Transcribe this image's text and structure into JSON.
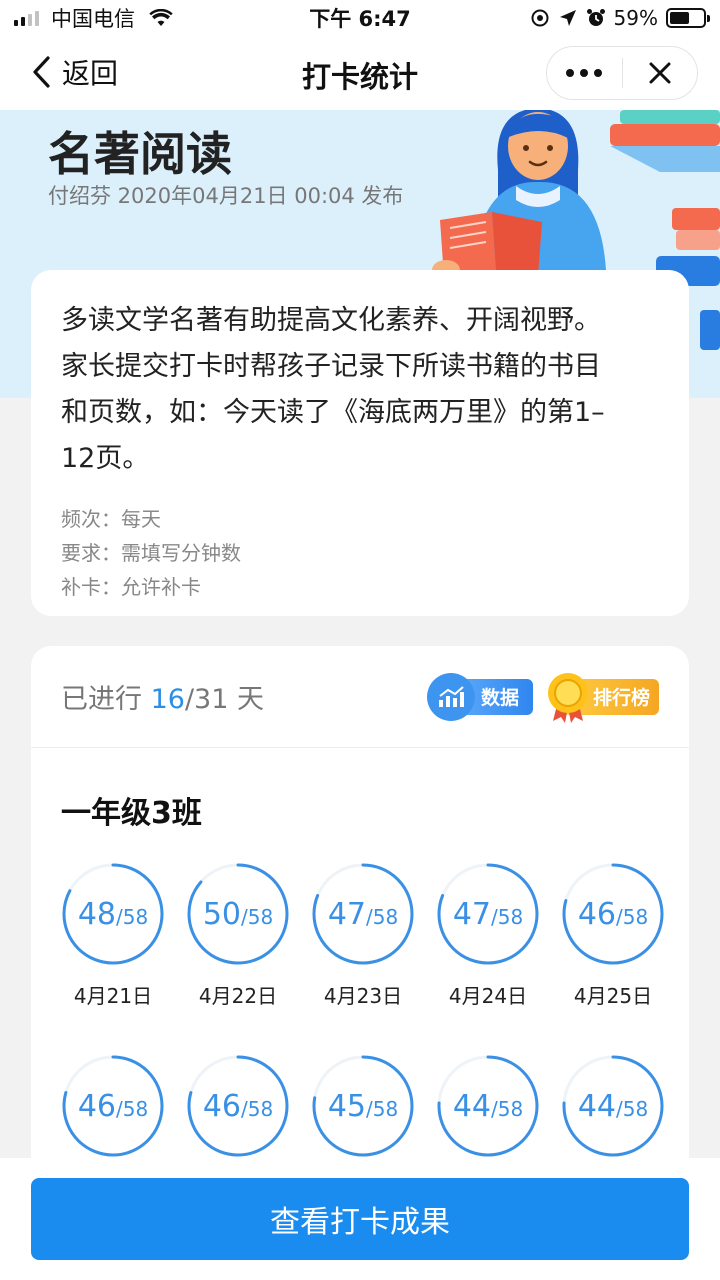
{
  "status_bar": {
    "carrier": "中国电信",
    "time": "下午 6:47",
    "battery_percent": "59%",
    "battery_level": 0.59
  },
  "nav": {
    "back_label": "返回",
    "title": "打卡统计"
  },
  "banner": {
    "title": "名著阅读",
    "meta": "付绍芬  2020年04月21日 00:04 发布"
  },
  "description": {
    "lines": [
      "多读文学名著有助提高文化素养、开阔视野。",
      "家长提交打卡时帮孩子记录下所读书籍的书目",
      "和页数，如：今天读了《海底两万里》的第1–",
      "12页。"
    ],
    "rules": [
      "频次：每天",
      "要求：需填写分钟数",
      "补卡：允许补卡"
    ]
  },
  "stats": {
    "progress_prefix": "已进行 ",
    "progress_current": "16",
    "progress_rest": "/31 天",
    "data_button_label": "数据",
    "rank_button_label": "排行榜",
    "class_name": "一年级3班",
    "days": [
      {
        "count": 48,
        "total_label": "/58",
        "date": "4月21日"
      },
      {
        "count": 50,
        "total_label": "/58",
        "date": "4月22日"
      },
      {
        "count": 47,
        "total_label": "/58",
        "date": "4月23日"
      },
      {
        "count": 47,
        "total_label": "/58",
        "date": "4月24日"
      },
      {
        "count": 46,
        "total_label": "/58",
        "date": "4月25日"
      },
      {
        "count": 46,
        "total_label": "/58",
        "date": ""
      },
      {
        "count": 46,
        "total_label": "/58",
        "date": ""
      },
      {
        "count": 45,
        "total_label": "/58",
        "date": ""
      },
      {
        "count": 44,
        "total_label": "/58",
        "date": ""
      },
      {
        "count": 44,
        "total_label": "/58",
        "date": ""
      }
    ],
    "total": 58
  },
  "bottom": {
    "result_button_label": "查看打卡成果"
  },
  "colors": {
    "accent": "#1a8cf0",
    "ring": "#3a90e5",
    "banner_bg": "#dcf0fb",
    "rank_gold": "#f5a623"
  },
  "icons": [
    "signal-icon",
    "wifi-icon",
    "location-icon",
    "alarm-icon",
    "battery-icon",
    "back-chevron-icon",
    "more-dots-icon",
    "close-icon",
    "chart-icon",
    "medal-icon"
  ]
}
